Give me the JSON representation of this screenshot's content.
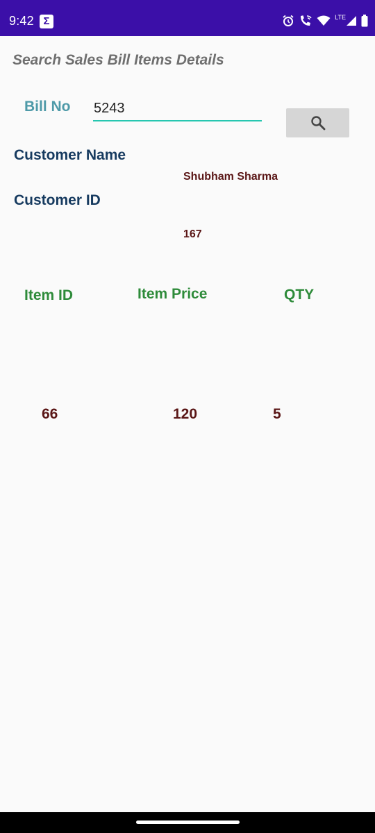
{
  "status_bar": {
    "time": "9:42",
    "app_icon_glyph": "Σ",
    "network_label": "LTE",
    "icons": [
      "alarm-icon",
      "wifi-calling-icon",
      "wifi-icon",
      "signal-icon",
      "battery-icon"
    ]
  },
  "page": {
    "title": "Search Sales Bill Items Details"
  },
  "bill": {
    "label": "Bill No",
    "value": "5243"
  },
  "search_button": {
    "icon": "search-icon"
  },
  "customer": {
    "name_label": "Customer Name",
    "name_value": "Shubham Sharma",
    "id_label": "Customer ID",
    "id_value": "167"
  },
  "items_table": {
    "headers": [
      "Item ID",
      "Item Price",
      "QTY"
    ],
    "rows": [
      [
        "66",
        "120",
        "5"
      ]
    ]
  },
  "colors": {
    "status_bar": "#3b0fa8",
    "bill_label": "#4e9aa8",
    "input_underline": "#26c6b0",
    "dark_label": "#163a5f",
    "value_text": "#5a1616",
    "table_header": "#2e8b3a",
    "button_bg": "#d6d6d6"
  }
}
